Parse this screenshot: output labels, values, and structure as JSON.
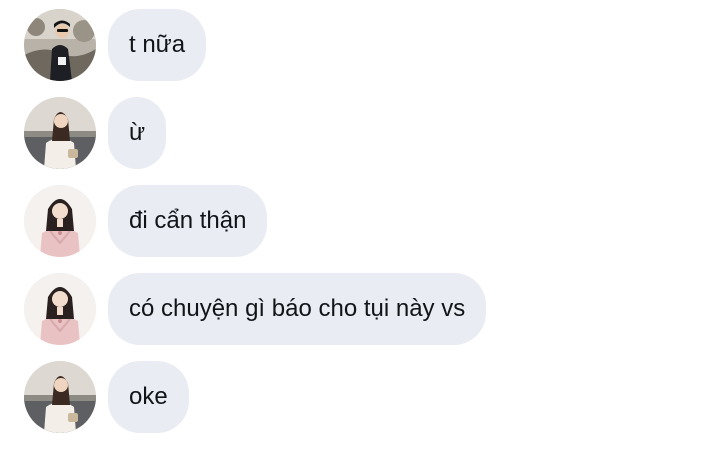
{
  "conversation": {
    "messages": [
      {
        "text": "t nữa",
        "avatar_icon": "avatar-guy-sunglasses-icon"
      },
      {
        "text": "ừ",
        "avatar_icon": "avatar-girl-cream-sweater-icon"
      },
      {
        "text": "đi cẩn thận",
        "avatar_icon": "avatar-girl-pink-dress-icon"
      },
      {
        "text": "có chuyện gì báo cho tụi này vs",
        "avatar_icon": "avatar-girl-pink-dress-icon"
      },
      {
        "text": "oke",
        "avatar_icon": "avatar-girl-cream-sweater-icon"
      }
    ]
  },
  "colors": {
    "bubble_background": "#e9ecf2",
    "message_text": "#111418",
    "page_background": "#ffffff"
  }
}
